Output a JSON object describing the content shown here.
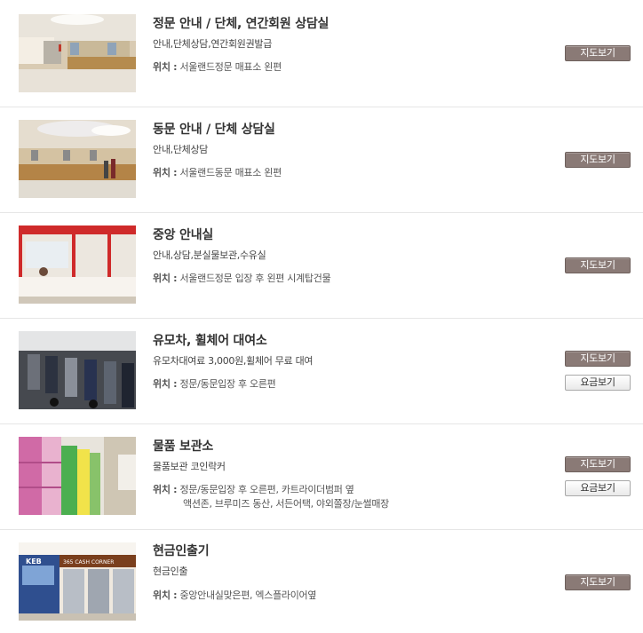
{
  "location_label": "위치 :",
  "items": [
    {
      "title": "정문 안내 / 단체, 연간회원 상담실",
      "desc": "안내,단체상담,연간회원권발급",
      "location_lines": [
        "서울랜드정문 매표소 왼편"
      ],
      "buttons": {
        "map": "지도보기"
      }
    },
    {
      "title": "동문 안내 / 단체 상담실",
      "desc": "안내,단체상담",
      "location_lines": [
        "서울랜드동문 매표소 왼편"
      ],
      "buttons": {
        "map": "지도보기"
      }
    },
    {
      "title": "중앙 안내실",
      "desc": "안내,상담,분실물보관,수유실",
      "location_lines": [
        "서울랜드정문 입장 후 왼편 시계탑건물"
      ],
      "buttons": {
        "map": "지도보기"
      }
    },
    {
      "title": "유모차, 휠체어 대여소",
      "desc": "유모차대여료 3,000원,휠체어 무료 대여",
      "location_lines": [
        "정문/동문입장 후 오른편"
      ],
      "buttons": {
        "map": "지도보기",
        "fee": "요금보기"
      }
    },
    {
      "title": "물품 보관소",
      "desc": "물품보관 코인락커",
      "location_lines": [
        "정문/동문입장 후 오른편, 카트라이더범퍼 옆",
        "액션존, 브루미즈 동산, 서든어택, 야외쫄장/눈썰매장"
      ],
      "buttons": {
        "map": "지도보기",
        "fee": "요금보기"
      }
    },
    {
      "title": "현금인출기",
      "desc": "현금인출",
      "location_lines": [
        "중앙안내실맞은편, 엑스플라이어옆"
      ],
      "buttons": {
        "map": "지도보기"
      }
    }
  ],
  "thumb_signs": {
    "atm_sign": "365 CASH CORNER",
    "atm_bank": "KEB"
  },
  "colors": {
    "map_button": "#8a7a76",
    "fee_button": "#f4f4f4",
    "divider": "#e6e6e6"
  }
}
